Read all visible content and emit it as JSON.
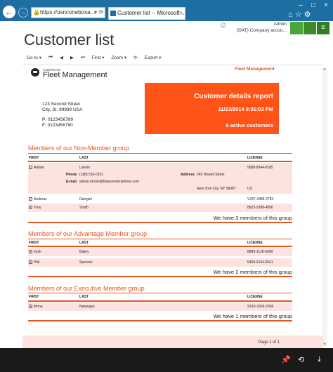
{
  "browser": {
    "url": "https://usnconeboxa...",
    "tab_title": "Customer list -- Microsoft ...",
    "tab_close": "×",
    "lock": "🔒",
    "url_icons": "▾ ⟳",
    "win_min": "–",
    "win_max": "□",
    "win_close": "×",
    "tool_icons": "⌂ ☆ ⚙"
  },
  "header": {
    "title": "Customer list",
    "user_name": "Admin",
    "company": "(DAT) Company accou...",
    "smiley": "☺",
    "help": "?"
  },
  "toolbar": {
    "goto": "Go to ▾",
    "first": "⏮",
    "prev": "◀",
    "next": "▶",
    "last": "⏭",
    "find": "Find ▾",
    "zoom": "Zoom ▾",
    "refresh": "⟳",
    "export": "Export ▾"
  },
  "report": {
    "brand_small": "FABRIKAM",
    "brand": "Fleet Management",
    "brand_right": "Fleet Management",
    "address_line1": "123 Second Street",
    "address_line2": "City, St. 99999 USA",
    "phone": "P: 0123456789",
    "fax": "F: 0123456780",
    "box_title": "Customer details report",
    "box_date": "11/13/2014 9:31:03 PM",
    "box_count": "6 active customers",
    "col_first": "FIRST",
    "col_last": "LAST",
    "col_license": "LICENSE",
    "groups": [
      {
        "title": "Members of our Non-Member group",
        "count_text": "We have 3 members of this group",
        "rows": [
          {
            "first": "Adrian",
            "last": "Lannin",
            "license": "5688-8944-8185",
            "phone_label": "Phone",
            "phone": "(188) 555-0101",
            "email_label": "E-mail",
            "email": "adrian.lannin@blueyonderairlines.com",
            "address_label": "Address",
            "street": "245 Howell Street",
            "city": "New York City, NY 99087",
            "country": "US"
          },
          {
            "first": "Andreas",
            "last": "Dzlegiel",
            "license": "V347-3489-2784"
          },
          {
            "first": "Tony",
            "last": "Smith",
            "license": "8923-2388-4956"
          }
        ]
      },
      {
        "title": "Members of our Advantage Member group",
        "count_text": "We have 2 members of this group",
        "rows": [
          {
            "first": "Josh",
            "last": "Bailey",
            "license": "8889-1128-6699"
          },
          {
            "first": "Phil",
            "last": "Spencer",
            "license": "5468-3164-6541"
          }
        ]
      },
      {
        "title": "Members of our Executive Member group",
        "count_text": "We have 1 members of this group",
        "rows": [
          {
            "first": "Mrina",
            "last": "Natarajan",
            "license": "S615-3939-2356"
          }
        ]
      }
    ],
    "page_of": "Page 1 of 1"
  },
  "appbar": {
    "pin": "📌",
    "sync": "⟲",
    "download": "⤓"
  },
  "colors": {
    "accent": "#e8541e",
    "box": "#ff5317",
    "row_highlight": "#fde3e0",
    "titlebar": "#1d6fa3"
  }
}
